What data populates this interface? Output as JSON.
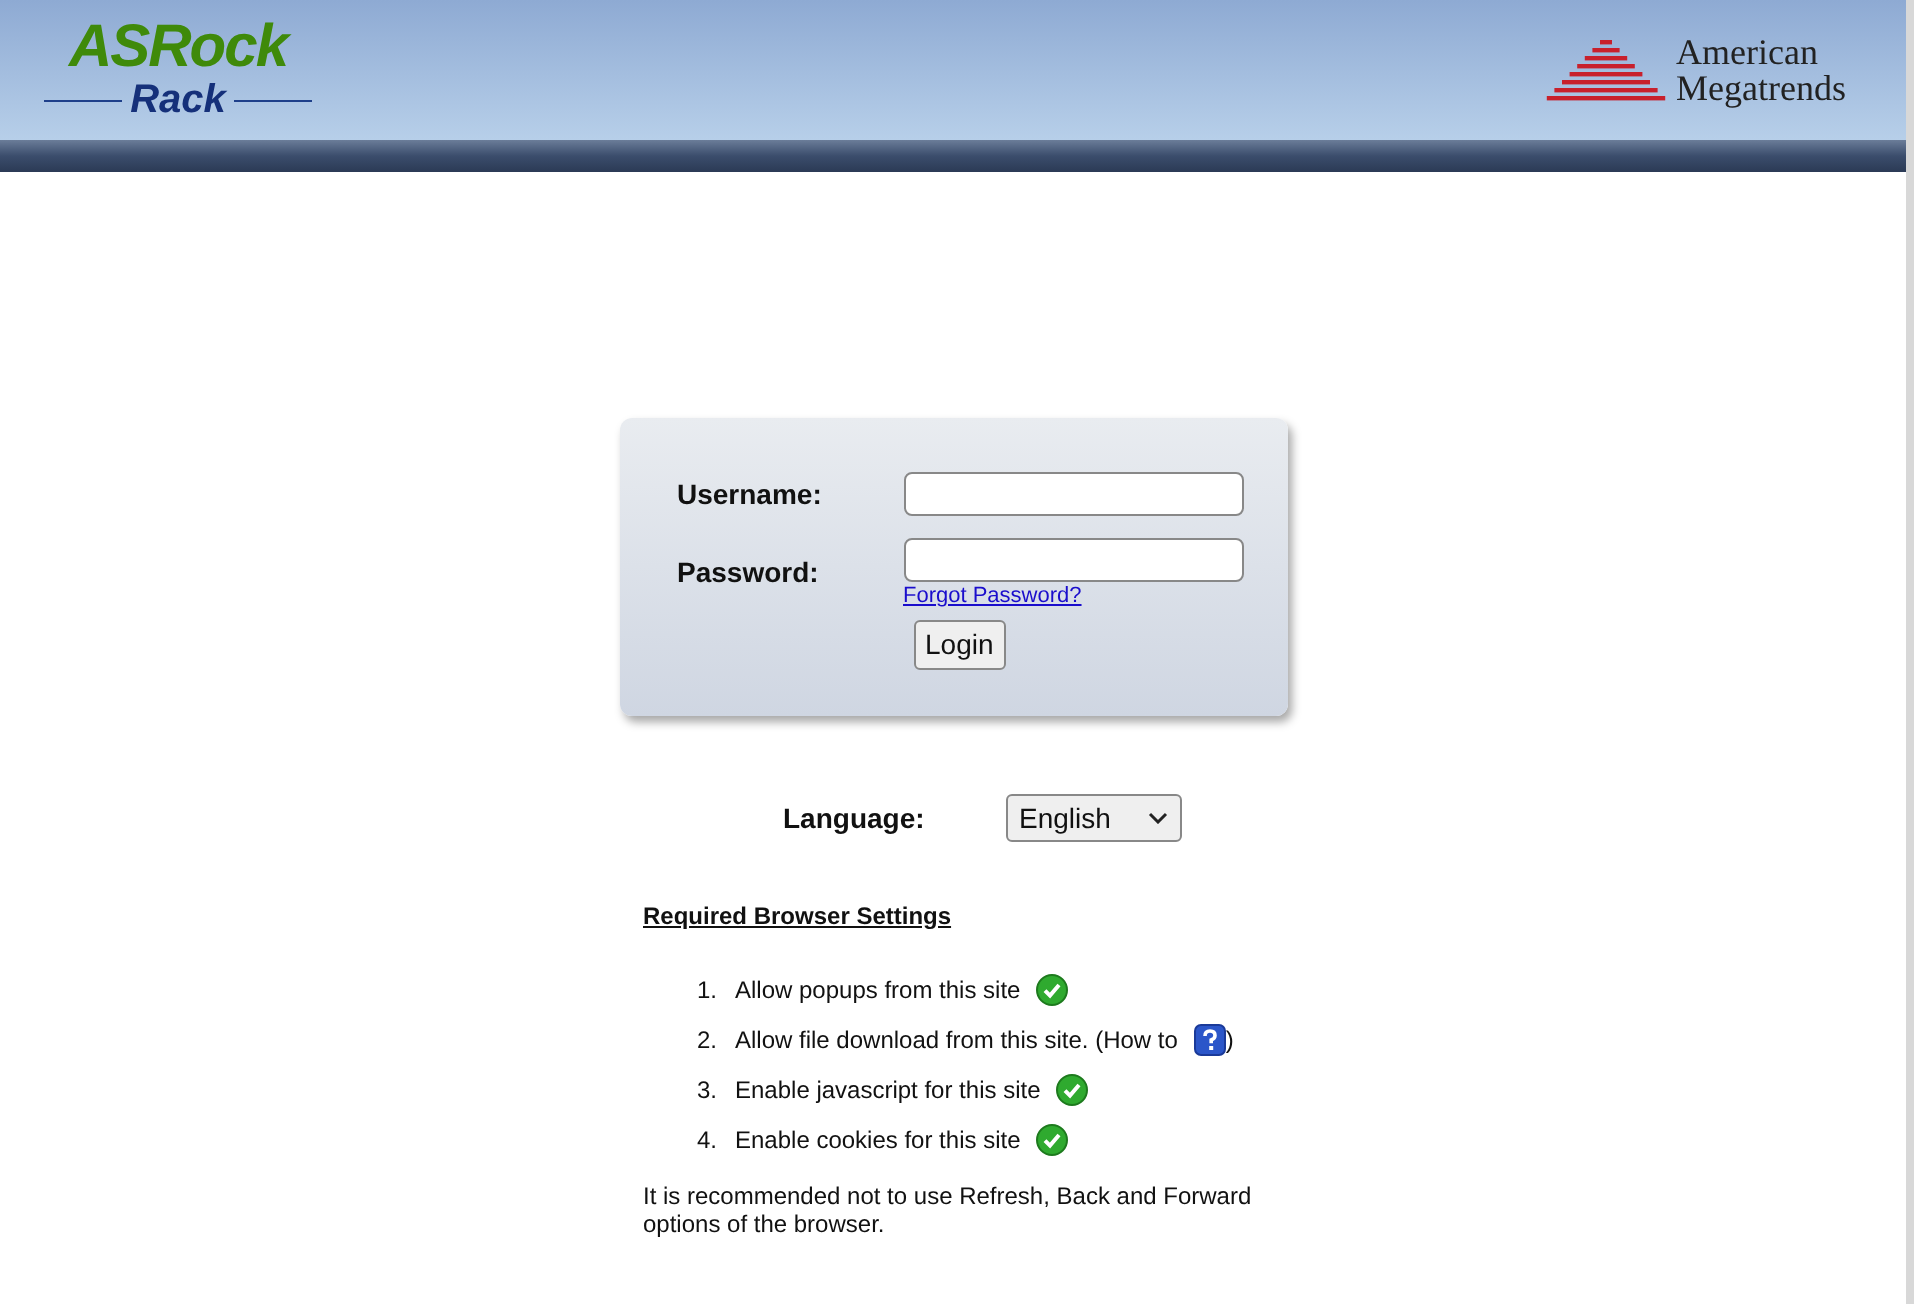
{
  "header": {
    "logo_left": {
      "top": "ASRock",
      "bottom": "Rack"
    },
    "logo_right": {
      "line1": "American",
      "line2": "Megatrends"
    }
  },
  "login": {
    "username_label": "Username:",
    "password_label": "Password:",
    "forgot_link": "Forgot Password?",
    "login_button": "Login"
  },
  "language": {
    "label": "Language:",
    "value": "English"
  },
  "settings": {
    "title": "Required Browser Settings",
    "items": [
      {
        "number": "1.",
        "text": "Allow popups from this site",
        "kind": "check"
      },
      {
        "number": "2.",
        "text": "Allow file download from this site. (How to",
        "kind": "help",
        "suffix": ")"
      },
      {
        "number": "3.",
        "text": "Enable javascript for this site",
        "kind": "check"
      },
      {
        "number": "4.",
        "text": "Enable cookies for this site",
        "kind": "check"
      }
    ],
    "note": "It is recommended not to use Refresh, Back and Forward options of the browser."
  }
}
